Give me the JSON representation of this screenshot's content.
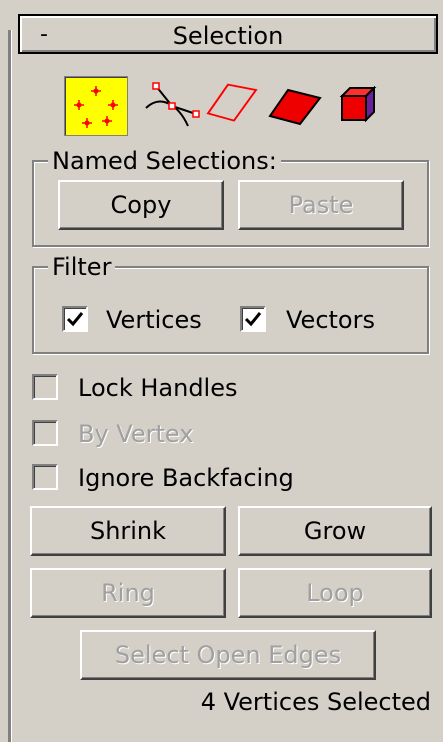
{
  "rollout": {
    "toggle_symbol": "-",
    "title": "Selection"
  },
  "selection_levels": [
    {
      "name": "vertex",
      "active": true
    },
    {
      "name": "segment",
      "active": false
    },
    {
      "name": "edge",
      "active": false
    },
    {
      "name": "polygon",
      "active": false
    },
    {
      "name": "element",
      "active": false
    }
  ],
  "named_selections": {
    "title": "Named Selections:",
    "copy_label": "Copy",
    "paste_label": "Paste"
  },
  "filter": {
    "title": "Filter",
    "vertices_label": "Vertices",
    "vertices_checked": true,
    "vectors_label": "Vectors",
    "vectors_checked": true
  },
  "options": {
    "lock_handles_label": "Lock Handles",
    "by_vertex_label": "By Vertex",
    "ignore_backfacing_label": "Ignore Backfacing"
  },
  "buttons": {
    "shrink_label": "Shrink",
    "grow_label": "Grow",
    "ring_label": "Ring",
    "loop_label": "Loop",
    "select_open_edges_label": "Select Open Edges"
  },
  "status": {
    "text": "4 Vertices Selected"
  },
  "colors": {
    "panel_bg": "#d4d0c8",
    "active_icon_bg": "#ffff00",
    "vertex_dot": "#ff0000",
    "disabled_text": "#a0a0a0"
  }
}
